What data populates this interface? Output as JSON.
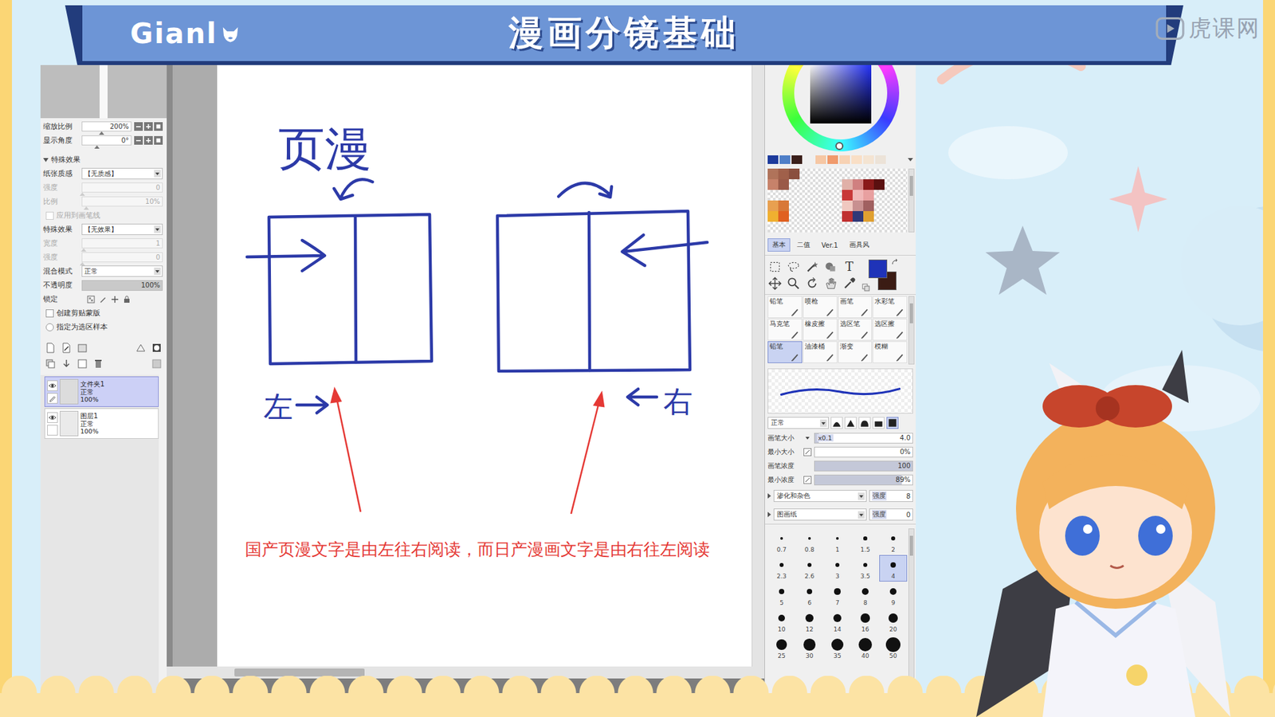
{
  "banner": {
    "logo": "Gianl",
    "title": "漫画分镜基础"
  },
  "watermark": "虎课网",
  "left_panel": {
    "rows": [
      {
        "kind": "zoom",
        "label": "缩放比例",
        "value": "200%",
        "level": 0.4,
        "disabled": false
      },
      {
        "kind": "zoom",
        "label": "显示角度",
        "value": "0°",
        "level": 0.3,
        "disabled": false
      },
      {
        "kind": "section",
        "label": "特殊效果",
        "expanded": true,
        "disabled": false
      },
      {
        "kind": "dropdown",
        "label": "纸张质感",
        "value": "【无质感】",
        "disabled": false
      },
      {
        "kind": "slider",
        "label": "强度",
        "value": "0",
        "level": 0,
        "disabled": true
      },
      {
        "kind": "slider",
        "label": "比例",
        "value": "10%",
        "level": 0.05,
        "disabled": true
      },
      {
        "kind": "checkbox",
        "label": "应用到画笔线",
        "checked": false,
        "disabled": true
      },
      {
        "kind": "dropdown",
        "label": "特殊效果",
        "value": "【无效果】",
        "disabled": false
      },
      {
        "kind": "slider",
        "label": "宽度",
        "value": "1",
        "level": 0.02,
        "disabled": true
      },
      {
        "kind": "slider",
        "label": "强度",
        "value": "0",
        "level": 0,
        "disabled": true
      },
      {
        "kind": "dropdown",
        "label": "混合模式",
        "value": "正常",
        "disabled": false
      },
      {
        "kind": "bar",
        "label": "不透明度",
        "value": "100%",
        "level": 1,
        "disabled": false
      },
      {
        "kind": "lock",
        "label": "锁定",
        "disabled": false
      },
      {
        "kind": "checkbox",
        "label": "创建剪贴蒙版",
        "checked": false,
        "disabled": false
      },
      {
        "kind": "radio",
        "label": "指定为选区样本",
        "checked": false,
        "disabled": false
      }
    ],
    "layers": [
      {
        "kind": "folder",
        "name": "文件夹1",
        "mode": "正常",
        "opacity": "100%",
        "visible": true,
        "selected": true
      },
      {
        "kind": "layer",
        "name": "图层1",
        "mode": "正常",
        "opacity": "100%",
        "visible": true,
        "selected": false
      }
    ]
  },
  "canvas": {
    "heading": "页漫",
    "left_label": "左",
    "right_label": "右",
    "caption": "国产页漫文字是由左往右阅读，而日产漫画文字是由右往左阅读"
  },
  "right_panel": {
    "colors": [
      {
        "color": "#1f33b8",
        "selected": true
      },
      {
        "color": "#3b1c14",
        "selected": false
      }
    ],
    "palette": [
      "#1d3b9c",
      "#4f7fc8",
      "#3a1f1a",
      "#f0f0f0",
      "#f6c7a4",
      "#f09a6c",
      "#f7d2b4",
      "#f9dfc6",
      "#f4e4d2",
      "#ece3d8"
    ],
    "swatches": [
      [
        "#b0735a",
        "#a0604a",
        "#8a4f3e",
        null,
        null,
        null,
        null,
        null,
        null,
        null,
        null,
        null
      ],
      [
        "#c7826a",
        "#9a5a48",
        null,
        null,
        null,
        null,
        null,
        "#e0b0a8",
        "#d08080",
        "#8a1a1a",
        "#5a1010",
        null
      ],
      [
        null,
        null,
        null,
        null,
        null,
        null,
        null,
        "#c83838",
        "#f0b8b8",
        "#e8a0a0",
        null,
        null
      ],
      [
        "#e8a050",
        "#d87838",
        null,
        null,
        null,
        null,
        null,
        "#f0c8c0",
        "#c89090",
        "#a06060",
        null,
        null
      ],
      [
        "#f0b030",
        "#e06020",
        null,
        null,
        null,
        null,
        null,
        "#c03030",
        "#303878",
        "#e0a030",
        null,
        null
      ]
    ],
    "tabs": [
      {
        "label": "基本",
        "selected": true
      },
      {
        "label": "二值",
        "selected": false
      },
      {
        "label": "Ver.1",
        "selected": false
      },
      {
        "label": "画具风",
        "selected": false
      }
    ],
    "tool_glyph": "T",
    "brushes": [
      {
        "label": "铅笔",
        "selected": false
      },
      {
        "label": "喷枪",
        "selected": false
      },
      {
        "label": "画笔",
        "selected": false
      },
      {
        "label": "水彩笔",
        "selected": false
      },
      {
        "label": "马克笔",
        "selected": false
      },
      {
        "label": "橡皮擦",
        "selected": false
      },
      {
        "label": "选区笔",
        "selected": false
      },
      {
        "label": "选区擦",
        "selected": false
      },
      {
        "label": "铅笔",
        "selected": true
      },
      {
        "label": "油漆桶",
        "selected": false
      },
      {
        "label": "渐变",
        "selected": false
      },
      {
        "label": "模糊",
        "selected": false
      }
    ],
    "blend_mode": "正常",
    "params": [
      {
        "label": "画笔大小",
        "prefix": "x0.1",
        "value": "4.0",
        "level": 0.04,
        "pressure": false
      },
      {
        "label": "最小大小",
        "value": "0%",
        "level": 0,
        "pressure": true
      },
      {
        "label": "画笔浓度",
        "value": "100",
        "level": 1,
        "pressure": false
      },
      {
        "label": "最小浓度",
        "value": "89%",
        "level": 0.89,
        "pressure": true
      }
    ],
    "textures": [
      {
        "name": "渗化和杂色",
        "strength_label": "强度",
        "value": "8"
      },
      {
        "name": "图画纸",
        "strength_label": "强度",
        "value": "0"
      }
    ],
    "sizes": [
      {
        "label": "0.7",
        "selected": false
      },
      {
        "label": "0.8",
        "selected": false
      },
      {
        "label": "1",
        "selected": false
      },
      {
        "label": "1.5",
        "selected": false
      },
      {
        "label": "2",
        "selected": false
      },
      {
        "label": "2.3",
        "selected": false
      },
      {
        "label": "2.6",
        "selected": false
      },
      {
        "label": "3",
        "selected": false
      },
      {
        "label": "3.5",
        "selected": false
      },
      {
        "label": "4",
        "selected": true
      },
      {
        "label": "5",
        "selected": false
      },
      {
        "label": "6",
        "selected": false
      },
      {
        "label": "7",
        "selected": false
      },
      {
        "label": "8",
        "selected": false
      },
      {
        "label": "9",
        "selected": false
      },
      {
        "label": "10",
        "selected": false
      },
      {
        "label": "12",
        "selected": false
      },
      {
        "label": "14",
        "selected": false
      },
      {
        "label": "16",
        "selected": false
      },
      {
        "label": "20",
        "selected": false
      },
      {
        "label": "25",
        "selected": false
      },
      {
        "label": "30",
        "selected": false
      },
      {
        "label": "35",
        "selected": false
      },
      {
        "label": "40",
        "selected": false
      },
      {
        "label": "50",
        "selected": false
      }
    ]
  }
}
